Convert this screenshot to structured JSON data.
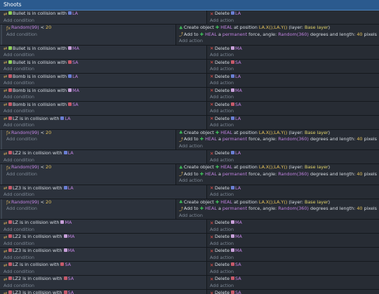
{
  "header": {
    "title": "Shoots"
  },
  "labels": {
    "add_condition": "Add condition",
    "add_action": "Add action",
    "is_in_collision_with": "is in collision with",
    "delete": "Delete",
    "create_object": "Create object",
    "at_position": "at position",
    "layer_prefix": "(layer:",
    "layer_suffix": ")",
    "add_to": "Add to",
    "a": "a",
    "permanent": "permanent",
    "force_angle": "force, angle:",
    "degrees_and_length": "degrees and length:",
    "pixels": "pixels",
    "lt": "<"
  },
  "events": [
    {
      "indent": 0,
      "cond": {
        "type": "collision",
        "obj": "Bullet",
        "target": "LA"
      },
      "actions": [
        {
          "type": "delete",
          "obj": "LA"
        }
      ]
    },
    {
      "indent": 1,
      "cond": {
        "type": "random",
        "expr": "Random(99)",
        "value": "20"
      },
      "actions": [
        {
          "type": "create",
          "obj": "HEAL",
          "position": "LA.X();LA.Y()",
          "layer": "Base layer"
        },
        {
          "type": "force",
          "obj": "HEAL",
          "angle": "Random(360)",
          "length": "40"
        }
      ]
    },
    {
      "indent": 0,
      "cond": {
        "type": "collision",
        "obj": "Bullet",
        "target": "MA"
      },
      "actions": [
        {
          "type": "delete",
          "obj": "MA"
        }
      ]
    },
    {
      "indent": 0,
      "cond": {
        "type": "collision",
        "obj": "Bullet",
        "target": "SA"
      },
      "actions": [
        {
          "type": "delete",
          "obj": "SA"
        }
      ]
    },
    {
      "indent": 0,
      "cond": {
        "type": "collision",
        "obj": "Bomb",
        "target": "LA"
      },
      "actions": [
        {
          "type": "delete",
          "obj": "LA"
        }
      ]
    },
    {
      "indent": 0,
      "cond": {
        "type": "collision",
        "obj": "Bomb",
        "target": "MA"
      },
      "actions": [
        {
          "type": "delete",
          "obj": "MA"
        }
      ]
    },
    {
      "indent": 0,
      "cond": {
        "type": "collision",
        "obj": "Bomb",
        "target": "SA"
      },
      "actions": [
        {
          "type": "delete",
          "obj": "SA"
        }
      ]
    },
    {
      "indent": 0,
      "cond": {
        "type": "collision",
        "obj": "LZ",
        "target": "LA"
      },
      "actions": [
        {
          "type": "delete",
          "obj": "LA"
        }
      ]
    },
    {
      "indent": 1,
      "cond": {
        "type": "random",
        "expr": "Random(99)",
        "value": "20"
      },
      "actions": [
        {
          "type": "create",
          "obj": "HEAL",
          "position": "LA.X();LA.Y()",
          "layer": "Base layer"
        },
        {
          "type": "force",
          "obj": "HEAL",
          "angle": "Random(360)",
          "length": "40"
        }
      ]
    },
    {
      "indent": 0,
      "cond": {
        "type": "collision",
        "obj": "LZ2",
        "target": "LA"
      },
      "actions": [
        {
          "type": "delete",
          "obj": "LA"
        }
      ]
    },
    {
      "indent": 1,
      "cond": {
        "type": "random",
        "expr": "Random(99)",
        "value": "20"
      },
      "actions": [
        {
          "type": "create",
          "obj": "HEAL",
          "position": "LA.X();LA.Y()",
          "layer": "Base layer"
        },
        {
          "type": "force",
          "obj": "HEAL",
          "angle": "Random(360)",
          "length": "40"
        }
      ]
    },
    {
      "indent": 0,
      "cond": {
        "type": "collision",
        "obj": "LZ3",
        "target": "LA"
      },
      "actions": [
        {
          "type": "delete",
          "obj": "LA"
        }
      ]
    },
    {
      "indent": 1,
      "cond": {
        "type": "random",
        "expr": "Random(99)",
        "value": "20"
      },
      "actions": [
        {
          "type": "create",
          "obj": "HEAL",
          "position": "LA.X();LA.Y()",
          "layer": "Base layer"
        },
        {
          "type": "force",
          "obj": "HEAL",
          "angle": "Random(360)",
          "length": "40"
        }
      ]
    },
    {
      "indent": 0,
      "cond": {
        "type": "collision",
        "obj": "LZ",
        "target": "MA"
      },
      "actions": [
        {
          "type": "delete",
          "obj": "MA"
        }
      ]
    },
    {
      "indent": 0,
      "cond": {
        "type": "collision",
        "obj": "LZ2",
        "target": "MA"
      },
      "actions": [
        {
          "type": "delete",
          "obj": "MA"
        }
      ]
    },
    {
      "indent": 0,
      "cond": {
        "type": "collision",
        "obj": "LZ3",
        "target": "MA"
      },
      "actions": [
        {
          "type": "delete",
          "obj": "MA"
        }
      ]
    },
    {
      "indent": 0,
      "cond": {
        "type": "collision",
        "obj": "LZ",
        "target": "SA"
      },
      "actions": [
        {
          "type": "delete",
          "obj": "SA"
        }
      ]
    },
    {
      "indent": 0,
      "cond": {
        "type": "collision",
        "obj": "LZ2",
        "target": "SA"
      },
      "actions": [
        {
          "type": "delete",
          "obj": "SA"
        }
      ]
    },
    {
      "indent": 0,
      "cond": {
        "type": "collision",
        "obj": "LZ3",
        "target": "SA"
      },
      "actions": [
        {
          "type": "delete",
          "obj": "SA"
        }
      ]
    }
  ],
  "object_colors": {
    "Bullet": "#8ed05a",
    "Bomb": "#c75a6a",
    "LZ": "#c75a6a",
    "LZ2": "#c75a6a",
    "LZ3": "#c75a6a",
    "LA": "#6a7fd4",
    "MA": "#c7a0d8",
    "SA": "#c75a6a",
    "HEAL": "#3fbf5a"
  },
  "colors": {
    "header": "#2b5a8e",
    "conditions_bg": "#2c323c",
    "actions_bg": "#272c34"
  }
}
